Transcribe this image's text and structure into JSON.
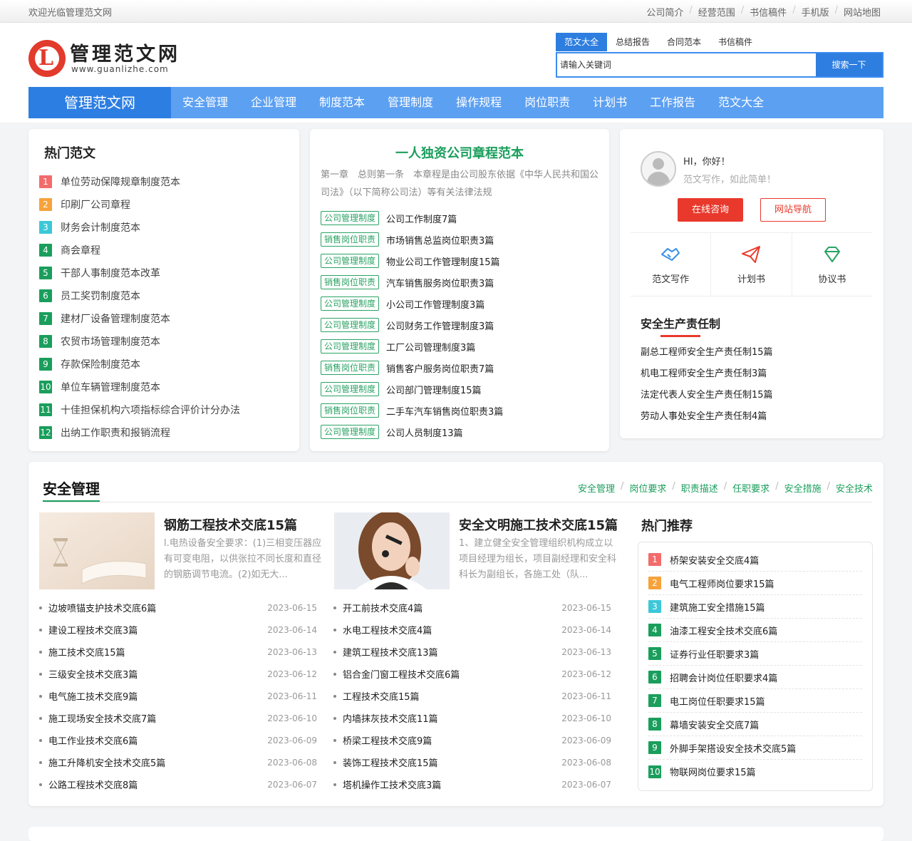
{
  "topbar": {
    "welcome": "欢迎光临管理范文网",
    "links": [
      "公司简介",
      "经营范围",
      "书信稿件",
      "手机版",
      "网站地图"
    ]
  },
  "logo": {
    "name": "管理范文网",
    "url": "www.guanlizhe.com",
    "letter": "L"
  },
  "search": {
    "tabs": [
      "范文大全",
      "总结报告",
      "合同范本",
      "书信稿件"
    ],
    "placeholder": "请输入关键词",
    "button": "搜索一下"
  },
  "nav": {
    "brand": "管理范文网",
    "items": [
      "安全管理",
      "企业管理",
      "制度范本",
      "管理制度",
      "操作规程",
      "岗位职责",
      "计划书",
      "工作报告",
      "范文大全"
    ]
  },
  "hot": {
    "title": "热门范文",
    "items": [
      {
        "num": "1",
        "text": "单位劳动保障规章制度范本"
      },
      {
        "num": "2",
        "text": "印刷厂公司章程"
      },
      {
        "num": "3",
        "text": "财务会计制度范本"
      },
      {
        "num": "4",
        "text": "商会章程"
      },
      {
        "num": "5",
        "text": "干部人事制度范本改革"
      },
      {
        "num": "6",
        "text": "员工奖罚制度范本"
      },
      {
        "num": "7",
        "text": "建材厂设备管理制度范本"
      },
      {
        "num": "8",
        "text": "农贸市场管理制度范本"
      },
      {
        "num": "9",
        "text": "存款保险制度范本"
      },
      {
        "num": "10",
        "text": "单位车辆管理制度范本"
      },
      {
        "num": "11",
        "text": "十佳担保机构六项指标综合评价计分办法"
      },
      {
        "num": "12",
        "text": "出纳工作职责和报销流程"
      }
    ]
  },
  "featured": {
    "title": "一人独资公司章程范本",
    "intro": "第一章　总则第一条　本章程是由公司股东依据《中华人民共和国公司法》（以下简称公司法）等有关法律法规",
    "items": [
      {
        "tag": "公司管理制度",
        "text": "公司工作制度7篇"
      },
      {
        "tag": "销售岗位职责",
        "text": "市场销售总监岗位职责3篇"
      },
      {
        "tag": "公司管理制度",
        "text": "物业公司工作管理制度15篇"
      },
      {
        "tag": "销售岗位职责",
        "text": "汽车销售服务岗位职责3篇"
      },
      {
        "tag": "公司管理制度",
        "text": "小公司工作管理制度3篇"
      },
      {
        "tag": "公司管理制度",
        "text": "公司财务工作管理制度3篇"
      },
      {
        "tag": "公司管理制度",
        "text": "工厂公司管理制度3篇"
      },
      {
        "tag": "销售岗位职责",
        "text": "销售客户服务岗位职责7篇"
      },
      {
        "tag": "公司管理制度",
        "text": "公司部门管理制度15篇"
      },
      {
        "tag": "销售岗位职责",
        "text": "二手车汽车销售岗位职责3篇"
      },
      {
        "tag": "公司管理制度",
        "text": "公司人员制度13篇"
      }
    ]
  },
  "user": {
    "hi": "HI，你好！",
    "slogan": "范文写作，如此简单！",
    "consult": "在线咨询",
    "nav": "网站导航",
    "shortcuts": [
      {
        "icon": "handshake-icon",
        "label": "范文写作"
      },
      {
        "icon": "paper-plane-icon",
        "label": "计划书"
      },
      {
        "icon": "diamond-icon",
        "label": "协议书"
      }
    ],
    "safety_title": "安全生产责任制",
    "safety_items": [
      "副总工程师安全生产责任制15篇",
      "机电工程师安全生产责任制3篇",
      "法定代表人安全生产责任制15篇",
      "劳动人事处安全生产责任制4篇"
    ]
  },
  "section": {
    "title": "安全管理",
    "links": [
      "安全管理",
      "岗位要求",
      "职责描述",
      "任职要求",
      "安全措施",
      "安全技术"
    ],
    "feature1": {
      "title": "钢筋工程技术交底15篇",
      "desc": "l.电热设备安全要求：(1)三相变压器应有可变电阻，以供张拉不同长度和直径的钢筋调节电流。(2)如无大..."
    },
    "feature2": {
      "title": "安全文明施工技术交底15篇",
      "desc": "1、建立健全安全管理组织机构成立以项目经理为组长，项目副经理和安全科科长为副组长，各施工处（队..."
    },
    "list1": [
      {
        "t": "边坡喷锚支护技术交底6篇",
        "d": "2023-06-15"
      },
      {
        "t": "建设工程技术交底3篇",
        "d": "2023-06-14"
      },
      {
        "t": "施工技术交底15篇",
        "d": "2023-06-13"
      },
      {
        "t": "三级安全技术交底3篇",
        "d": "2023-06-12"
      },
      {
        "t": "电气施工技术交底9篇",
        "d": "2023-06-11"
      },
      {
        "t": "施工现场安全技术交底7篇",
        "d": "2023-06-10"
      },
      {
        "t": "电工作业技术交底6篇",
        "d": "2023-06-09"
      },
      {
        "t": "施工升降机安全技术交底5篇",
        "d": "2023-06-08"
      },
      {
        "t": "公路工程技术交底8篇",
        "d": "2023-06-07"
      }
    ],
    "list2": [
      {
        "t": "开工前技术交底4篇",
        "d": "2023-06-15"
      },
      {
        "t": "水电工程技术交底4篇",
        "d": "2023-06-14"
      },
      {
        "t": "建筑工程技术交底13篇",
        "d": "2023-06-13"
      },
      {
        "t": "铝合金门窗工程技术交底6篇",
        "d": "2023-06-12"
      },
      {
        "t": "工程技术交底15篇",
        "d": "2023-06-11"
      },
      {
        "t": "内墙抹灰技术交底11篇",
        "d": "2023-06-10"
      },
      {
        "t": "桥梁工程技术交底9篇",
        "d": "2023-06-09"
      },
      {
        "t": "装饰工程技术交底15篇",
        "d": "2023-06-08"
      },
      {
        "t": "塔机操作工技术交底3篇",
        "d": "2023-06-07"
      }
    ],
    "rec_title": "热门推荐",
    "rec": [
      {
        "num": "1",
        "text": "桥架安装安全交底4篇"
      },
      {
        "num": "2",
        "text": "电气工程师岗位要求15篇"
      },
      {
        "num": "3",
        "text": "建筑施工安全措施15篇"
      },
      {
        "num": "4",
        "text": "油漆工程安全技术交底6篇"
      },
      {
        "num": "5",
        "text": "证券行业任职要求3篇"
      },
      {
        "num": "6",
        "text": "招聘会计岗位任职要求4篇"
      },
      {
        "num": "7",
        "text": "电工岗位任职要求15篇"
      },
      {
        "num": "8",
        "text": "幕墙安装安全交底7篇"
      },
      {
        "num": "9",
        "text": "外脚手架搭设安全技术交底5篇"
      },
      {
        "num": "10",
        "text": "物联网岗位要求15篇"
      }
    ]
  },
  "colors": {
    "nav_blue": "#5ca0f2",
    "brand_blue": "#2d7ee2",
    "green": "#1a9e5c",
    "red": "#e8392c",
    "num1": "#f36b6b",
    "num2": "#f7a23b",
    "num3": "#3cc8d8",
    "num_rest": "#1a9e5c"
  }
}
